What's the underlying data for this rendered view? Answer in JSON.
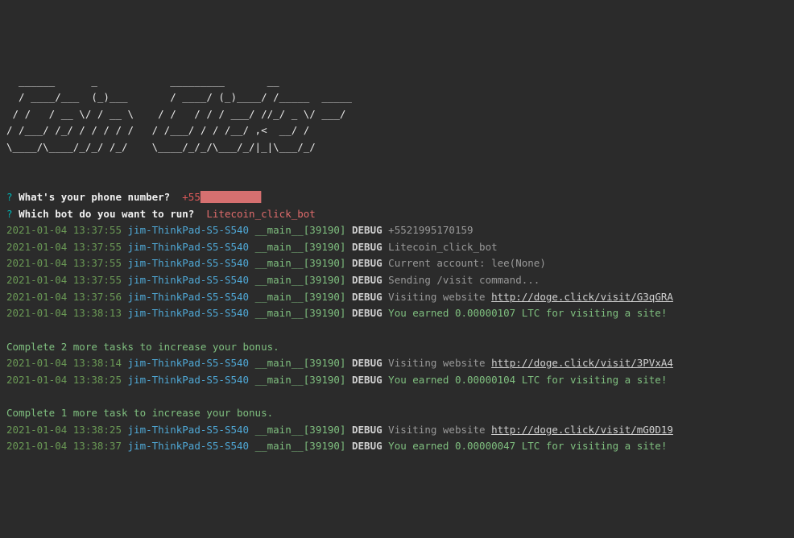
{
  "ascii": [
    "  ______      _            _________       __",
    "  / ____/___  (_)___       / ____/ (_)____/ /_____  _____",
    " / /   / __ \\/ / __ \\    / /   / / / ___/ //_/ _ \\/ ___/",
    "/ /___/ /_/ / / / / /   / /___/ / / /__/ ,<  __/ /",
    "\\____/\\____/_/_/ /_/    \\____/_/_/\\___/_/|_|\\___/_/"
  ],
  "prompts": {
    "q1": "?",
    "p1": "What's your phone number?",
    "phone_prefix": "+55",
    "phone_redacted": "██████████",
    "q2": "?",
    "p2": "Which bot do you want to run?",
    "bot": "Litecoin_click_bot"
  },
  "logs": [
    {
      "ts": "2021-01-04 13:37:55",
      "host": "jim-ThinkPad-S5-S540",
      "mod": "__main__[39190]",
      "lvl": "DEBUG",
      "msg": "+5521995170159"
    },
    {
      "ts": "2021-01-04 13:37:55",
      "host": "jim-ThinkPad-S5-S540",
      "mod": "__main__[39190]",
      "lvl": "DEBUG",
      "msg": "Litecoin_click_bot"
    },
    {
      "ts": "2021-01-04 13:37:55",
      "host": "jim-ThinkPad-S5-S540",
      "mod": "__main__[39190]",
      "lvl": "DEBUG",
      "msg": "Current account: lee(None)"
    },
    {
      "ts": "2021-01-04 13:37:55",
      "host": "jim-ThinkPad-S5-S540",
      "mod": "__main__[39190]",
      "lvl": "DEBUG",
      "msg": "Sending /visit command..."
    },
    {
      "ts": "2021-01-04 13:37:56",
      "host": "jim-ThinkPad-S5-S540",
      "mod": "__main__[39190]",
      "lvl": "DEBUG",
      "msg": "Visiting website",
      "url": "http://doge.click/visit/G3qGRA"
    },
    {
      "ts": "2021-01-04 13:38:13",
      "host": "jim-ThinkPad-S5-S540",
      "mod": "__main__[39190]",
      "lvl": "DEBUG",
      "earn": "You earned 0.00000107 LTC for visiting a site!"
    }
  ],
  "bonus1": "Complete 2 more tasks to increase your bonus.",
  "logs2": [
    {
      "ts": "2021-01-04 13:38:14",
      "host": "jim-ThinkPad-S5-S540",
      "mod": "__main__[39190]",
      "lvl": "DEBUG",
      "msg": "Visiting website",
      "url": "http://doge.click/visit/3PVxA4"
    },
    {
      "ts": "2021-01-04 13:38:25",
      "host": "jim-ThinkPad-S5-S540",
      "mod": "__main__[39190]",
      "lvl": "DEBUG",
      "earn": "You earned 0.00000104 LTC for visiting a site!"
    }
  ],
  "bonus2": "Complete 1 more task to increase your bonus.",
  "logs3": [
    {
      "ts": "2021-01-04 13:38:25",
      "host": "jim-ThinkPad-S5-S540",
      "mod": "__main__[39190]",
      "lvl": "DEBUG",
      "msg": "Visiting website",
      "url": "http://doge.click/visit/mG0D19"
    },
    {
      "ts": "2021-01-04 13:38:37",
      "host": "jim-ThinkPad-S5-S540",
      "mod": "__main__[39190]",
      "lvl": "DEBUG",
      "earn": "You earned 0.00000047 LTC for visiting a site!"
    }
  ]
}
